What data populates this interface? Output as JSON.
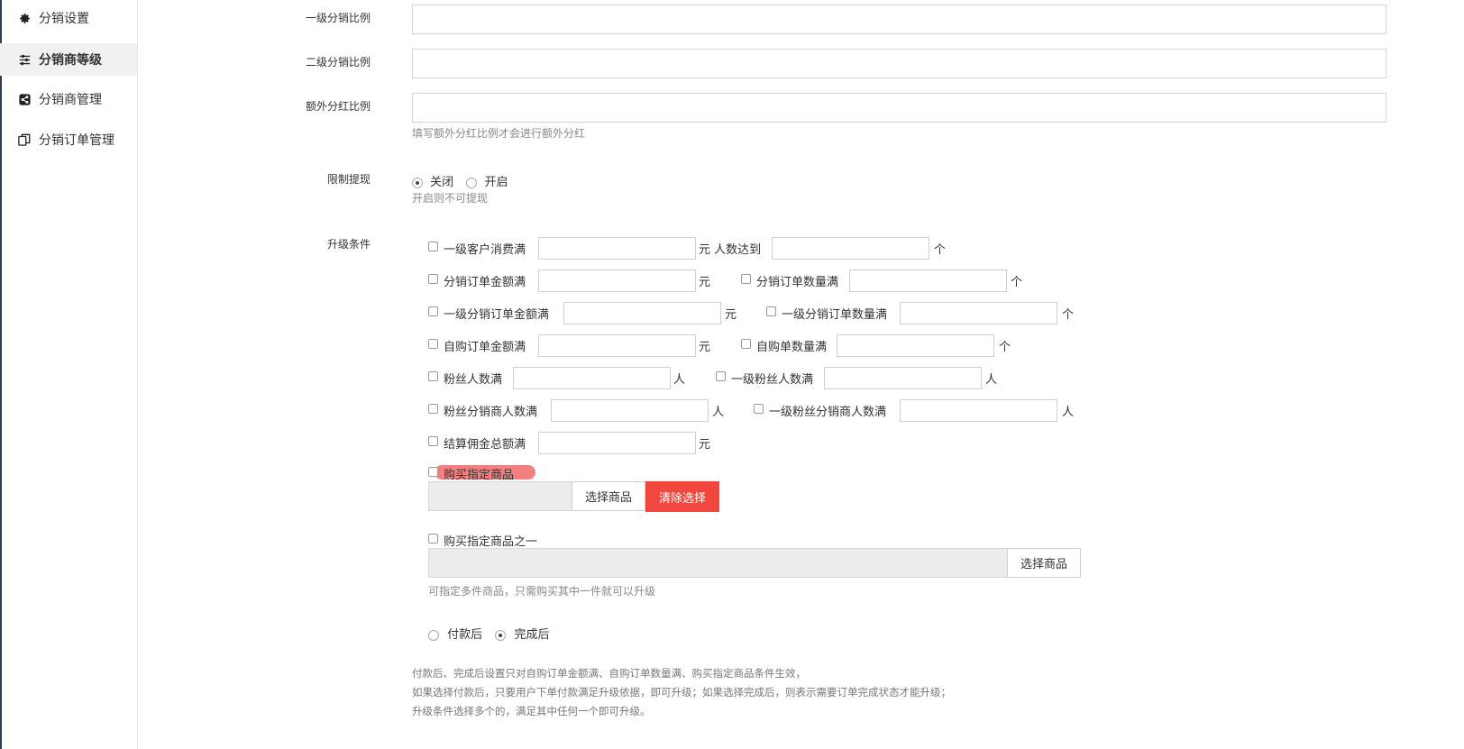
{
  "sidebar": {
    "items": [
      {
        "label": "分销设置",
        "icon": "gear-icon",
        "active": false
      },
      {
        "label": "分销商等级",
        "icon": "sliders-icon",
        "active": true
      },
      {
        "label": "分销商管理",
        "icon": "share-icon",
        "active": false
      },
      {
        "label": "分销订单管理",
        "icon": "copy-icon",
        "active": false
      }
    ]
  },
  "form": {
    "level1_ratio_label": "一级分销比例",
    "level2_ratio_label": "二级分销比例",
    "extra_bonus_label": "额外分红比例",
    "extra_bonus_hint": "填写额外分红比例才会进行额外分红",
    "withdraw_label": "限制提现",
    "withdraw_off": "关闭",
    "withdraw_on": "开启",
    "withdraw_hint": "开启则不可提现",
    "upgrade_label": "升级条件",
    "conditions": {
      "c1": "一级客户消费满",
      "c1_unit": "元 人数达到",
      "c1_unit2": "个",
      "c2": "分销订单金额满",
      "c2_unit": "元",
      "c3": "分销订单数量满",
      "c3_unit": "个",
      "c4": "一级分销订单金额满",
      "c4_unit": "元",
      "c5": "一级分销订单数量满",
      "c5_unit": "个",
      "c6": "自购订单金额满",
      "c6_unit": "元",
      "c7": "自购单数量满",
      "c7_unit": "个",
      "c8": "粉丝人数满",
      "c8_unit": "人",
      "c9": "一级粉丝人数满",
      "c9_unit": "人",
      "c10": "粉丝分销商人数满",
      "c10_unit": "人",
      "c11": "一级粉丝分销商人数满",
      "c11_unit": "人",
      "c12": "结算佣金总额满",
      "c12_unit": "元",
      "c13": "购买指定商品",
      "c14": "购买指定商品之一"
    },
    "select_goods_button": "选择商品",
    "clear_selection_button": "清除选择",
    "multi_goods_hint": "可指定多件商品，只需购买其中一件就可以升级",
    "timing_after_payment": "付款后",
    "timing_after_complete": "完成后",
    "notes": [
      "付款后、完成后设置只对自购订单金额满、自购订单数量满、购买指定商品条件生效，",
      "如果选择付款后，只要用户下单付款满足升级依据，即可升级；如果选择完成后，则表示需要订单完成状态才能升级；",
      "升级条件选择多个的，满足其中任何一个即可升级。"
    ]
  }
}
